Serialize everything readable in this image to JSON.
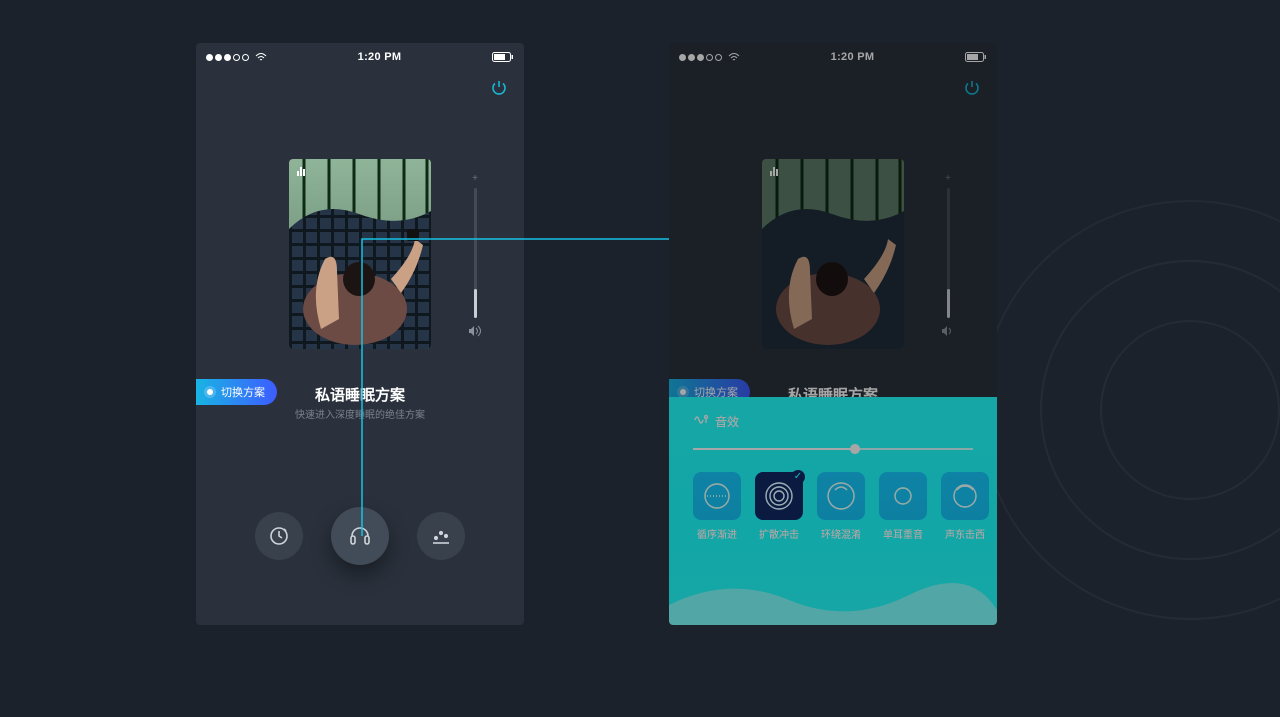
{
  "status": {
    "time": "1:20 PM"
  },
  "plan": {
    "title": "私语睡眠方案",
    "subtitle": "快速进入深度睡眠的绝佳方案",
    "switch_label": "切换方案"
  },
  "volume": {
    "plus": "+",
    "percent": 22
  },
  "controls": {
    "timer": "timer",
    "effects": "effects",
    "stats": "stats"
  },
  "panel": {
    "header": "音效",
    "slider_pct": 58,
    "items": [
      {
        "label": "循序渐进",
        "selected": false
      },
      {
        "label": "扩散冲击",
        "selected": true
      },
      {
        "label": "环绕混淆",
        "selected": false
      },
      {
        "label": "单耳重音",
        "selected": false
      },
      {
        "label": "声东击西",
        "selected": false
      }
    ]
  }
}
